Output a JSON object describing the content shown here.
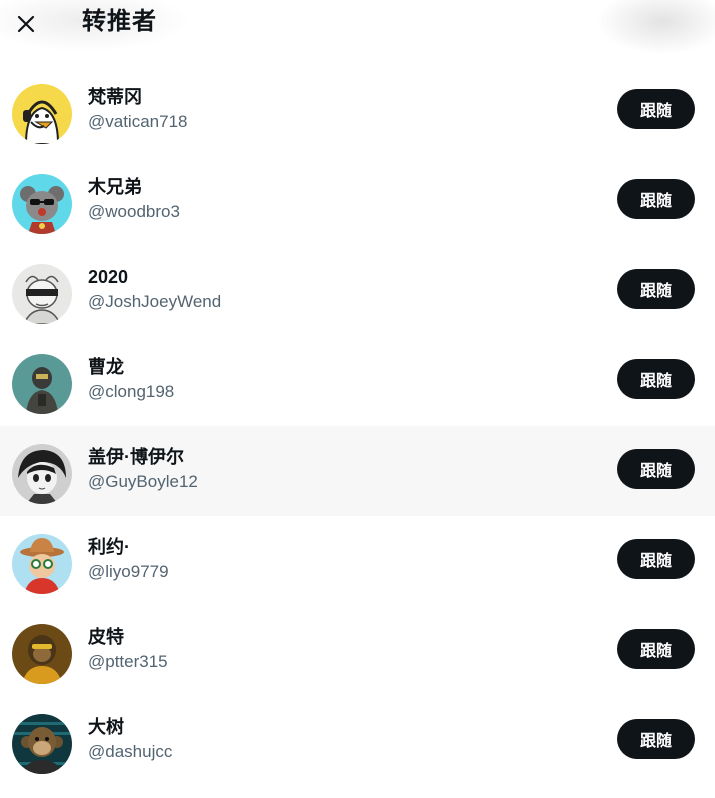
{
  "header": {
    "title": "转推者",
    "close_icon": "close-icon"
  },
  "follow_label": "跟随",
  "users": [
    {
      "name": "梵蒂冈",
      "handle": "@vatican718",
      "avatar": "duck-headset-avatar"
    },
    {
      "name": "木兄弟",
      "handle": "@woodbro3",
      "avatar": "cartoon-mouse-sunglasses-avatar"
    },
    {
      "name": "2020",
      "handle": "@JoshJoeyWend",
      "avatar": "blindfold-character-avatar"
    },
    {
      "name": "曹龙",
      "handle": "@clong198",
      "avatar": "teal-robot-avatar"
    },
    {
      "name": "盖伊·博伊尔",
      "handle": "@GuyBoyle12",
      "avatar": "anime-sketch-avatar"
    },
    {
      "name": "利约·",
      "handle": "@liyo9779",
      "avatar": "cowboy-hat-cartoon-avatar"
    },
    {
      "name": "皮特",
      "handle": "@ptter315",
      "avatar": "ape-gold-avatar"
    },
    {
      "name": "大树",
      "handle": "@dashujcc",
      "avatar": "bored-ape-avatar"
    }
  ],
  "colors": {
    "button_bg": "#0f1419",
    "handle_text": "#536471",
    "hover_row": "#f7f7f7"
  }
}
